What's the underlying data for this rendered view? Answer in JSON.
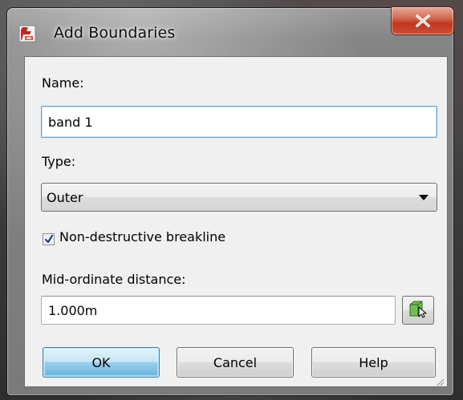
{
  "window": {
    "title": "Add Boundaries",
    "icon": "autocad-civil-icon",
    "close_icon": "close-icon"
  },
  "name_field": {
    "label": "Name:",
    "value": "band 1"
  },
  "type_field": {
    "label": "Type:",
    "selected": "Outer"
  },
  "breakline_checkbox": {
    "label": "Non-destructive breakline",
    "checked": true
  },
  "mid_ordinate": {
    "label": "Mid-ordinate distance:",
    "value": "1.000m",
    "pick_icon": "pick-from-drawing-icon"
  },
  "buttons": {
    "ok": "OK",
    "cancel": "Cancel",
    "help": "Help"
  },
  "colors": {
    "close_button": "#c2361c",
    "default_button": "#98d1ef",
    "focus_border": "#5ea6e0"
  }
}
